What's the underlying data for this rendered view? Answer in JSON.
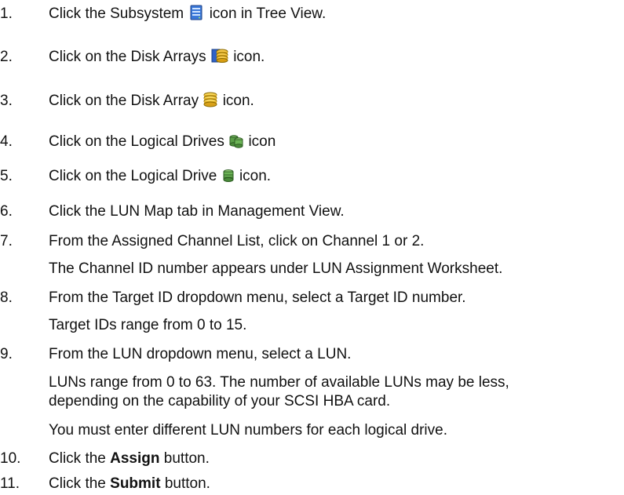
{
  "steps": [
    {
      "num": "1.",
      "before": "Click the Subsystem",
      "icon": "subsystem-icon",
      "after": "icon in Tree View."
    },
    {
      "num": "2.",
      "before": "Click on the Disk Arrays",
      "icon": "disk-arrays-icon",
      "after": "icon."
    },
    {
      "num": "3.",
      "before": "Click on the Disk Array",
      "icon": "disk-array-icon",
      "after": "icon."
    },
    {
      "num": "4.",
      "before": "Click on the Logical Drives",
      "icon": "logical-drives-icon",
      "after": "icon"
    },
    {
      "num": "5.",
      "before": "Click on the Logical Drive",
      "icon": "logical-drive-icon",
      "after": "icon."
    },
    {
      "num": "6.",
      "text": "Click the LUN Map tab in Management View."
    },
    {
      "num": "7.",
      "text": "From the Assigned Channel List, click on Channel 1 or 2.",
      "note": "The Channel ID number appears under LUN Assignment Worksheet."
    },
    {
      "num": "8.",
      "text": "From the Target ID dropdown menu, select a Target ID number.",
      "note": "Target IDs range from 0 to 15."
    },
    {
      "num": "9.",
      "text": "From the LUN dropdown menu, select a LUN.",
      "note1_line1": "LUNs range from 0 to 63. The number of available LUNs may be less,",
      "note1_line2": "depending on the capability of your SCSI HBA card.",
      "note2": "You must enter different LUN numbers for each logical drive."
    },
    {
      "num": "10.",
      "before": "Click the",
      "bold": "Assign",
      "after": "button."
    },
    {
      "num": "11.",
      "before": "Click the",
      "bold": "Submit",
      "after": "button."
    }
  ]
}
